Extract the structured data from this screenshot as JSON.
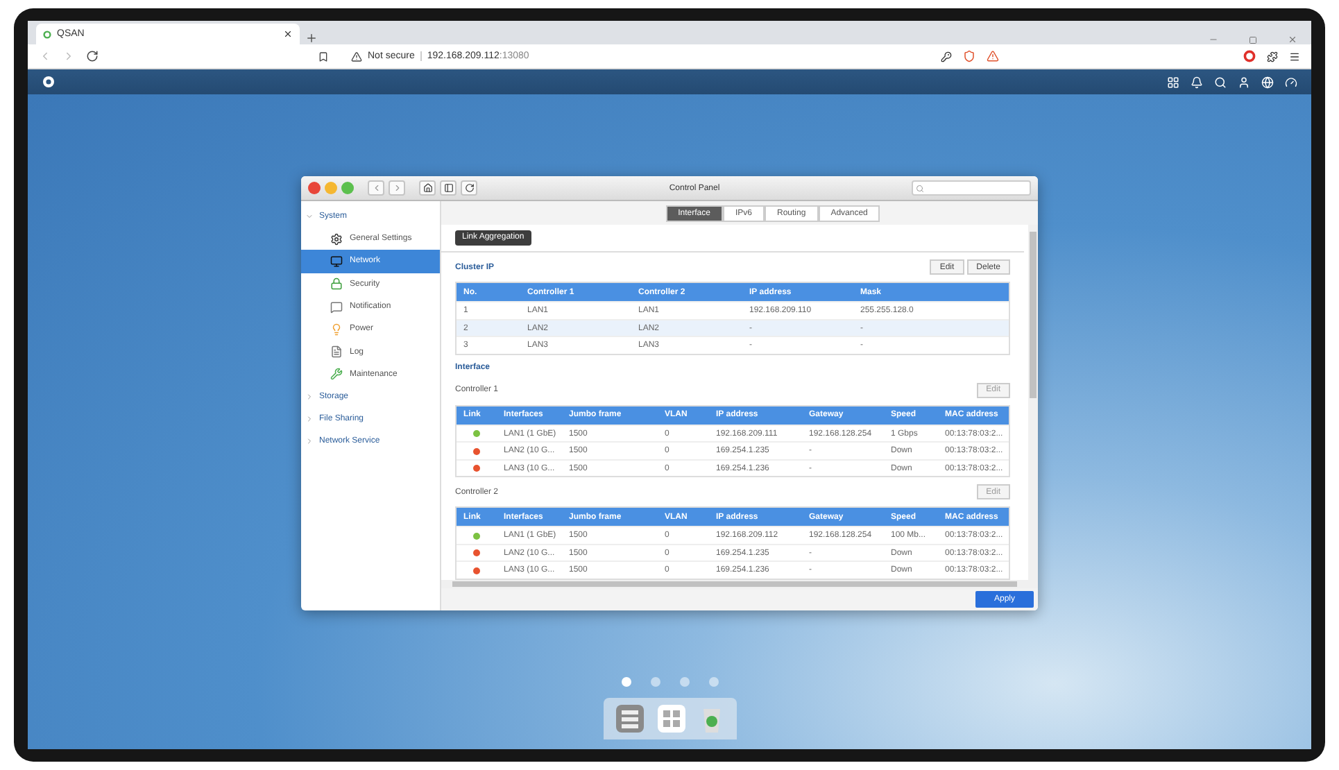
{
  "browser": {
    "tab_title": "QSAN",
    "warning": "Not secure",
    "url_host": "192.168.209.112",
    "url_port": ":13080"
  },
  "window": {
    "title": "Control Panel"
  },
  "sidebar": {
    "items": [
      {
        "label": "System",
        "expanded": true,
        "children": [
          {
            "label": "General Settings",
            "selected": false
          },
          {
            "label": "Network",
            "selected": true
          },
          {
            "label": "Security",
            "selected": false
          },
          {
            "label": "Notification",
            "selected": false
          },
          {
            "label": "Power",
            "selected": false
          },
          {
            "label": "Log",
            "selected": false
          },
          {
            "label": "Maintenance",
            "selected": false
          }
        ]
      },
      {
        "label": "Storage",
        "expanded": false
      },
      {
        "label": "File Sharing",
        "expanded": false
      },
      {
        "label": "Network Service",
        "expanded": false
      }
    ]
  },
  "tabs": [
    {
      "label": "Interface",
      "selected": true
    },
    {
      "label": "IPv6",
      "selected": false
    },
    {
      "label": "Routing",
      "selected": false
    },
    {
      "label": "Advanced",
      "selected": false
    }
  ],
  "link_aggregation": "Link Aggregation",
  "cluster_ip": {
    "title": "Cluster IP",
    "buttons": [
      {
        "label": "Edit",
        "disabled": false
      },
      {
        "label": "Delete",
        "disabled": false
      }
    ],
    "columns": [
      "No.",
      "Controller 1",
      "Controller 2",
      "IP address",
      "Mask"
    ],
    "rows": [
      {
        "selected": false,
        "cells": [
          "1",
          "LAN1",
          "LAN1",
          "192.168.209.110",
          "255.255.128.0"
        ]
      },
      {
        "selected": true,
        "cells": [
          "2",
          "LAN2",
          "LAN2",
          "-",
          "-"
        ]
      },
      {
        "selected": false,
        "cells": [
          "3",
          "LAN3",
          "LAN3",
          "-",
          "-"
        ]
      }
    ]
  },
  "interface": {
    "title": "Interface",
    "controllers": [
      {
        "name": "Controller 1",
        "edit": {
          "label": "Edit",
          "disabled": true
        },
        "columns": [
          "Link",
          "Interfaces",
          "Jumbo frame",
          "VLAN",
          "IP address",
          "Gateway",
          "Speed",
          "MAC address"
        ],
        "rows": [
          {
            "color": "#7cc242",
            "cells": [
              "",
              "LAN1 (1 GbE)",
              "1500",
              "0",
              "192.168.209.111",
              "192.168.128.254",
              "1 Gbps",
              "00:13:78:03:2..."
            ]
          },
          {
            "color": "#e8532f",
            "cells": [
              "",
              "LAN2 (10 G...",
              "1500",
              "0",
              "169.254.1.235",
              "-",
              "Down",
              "00:13:78:03:2..."
            ]
          },
          {
            "color": "#e8532f",
            "cells": [
              "",
              "LAN3 (10 G...",
              "1500",
              "0",
              "169.254.1.236",
              "-",
              "Down",
              "00:13:78:03:2..."
            ]
          }
        ]
      },
      {
        "name": "Controller 2",
        "edit": {
          "label": "Edit",
          "disabled": true
        },
        "columns": [
          "Link",
          "Interfaces",
          "Jumbo frame",
          "VLAN",
          "IP address",
          "Gateway",
          "Speed",
          "MAC address"
        ],
        "rows": [
          {
            "color": "#7cc242",
            "cells": [
              "",
              "LAN1 (1 GbE)",
              "1500",
              "0",
              "192.168.209.112",
              "192.168.128.254",
              "100 Mb...",
              "00:13:78:03:2..."
            ]
          },
          {
            "color": "#e8532f",
            "cells": [
              "",
              "LAN2 (10 G...",
              "1500",
              "0",
              "169.254.1.235",
              "-",
              "Down",
              "00:13:78:03:2..."
            ]
          },
          {
            "color": "#e8532f",
            "cells": [
              "",
              "LAN3 (10 G...",
              "1500",
              "0",
              "169.254.1.236",
              "-",
              "Down",
              "00:13:78:03:2..."
            ]
          }
        ]
      }
    ]
  },
  "apply": "Apply",
  "desktop_pages": [
    {
      "selected": true
    },
    {
      "selected": false
    },
    {
      "selected": false
    },
    {
      "selected": false
    }
  ]
}
